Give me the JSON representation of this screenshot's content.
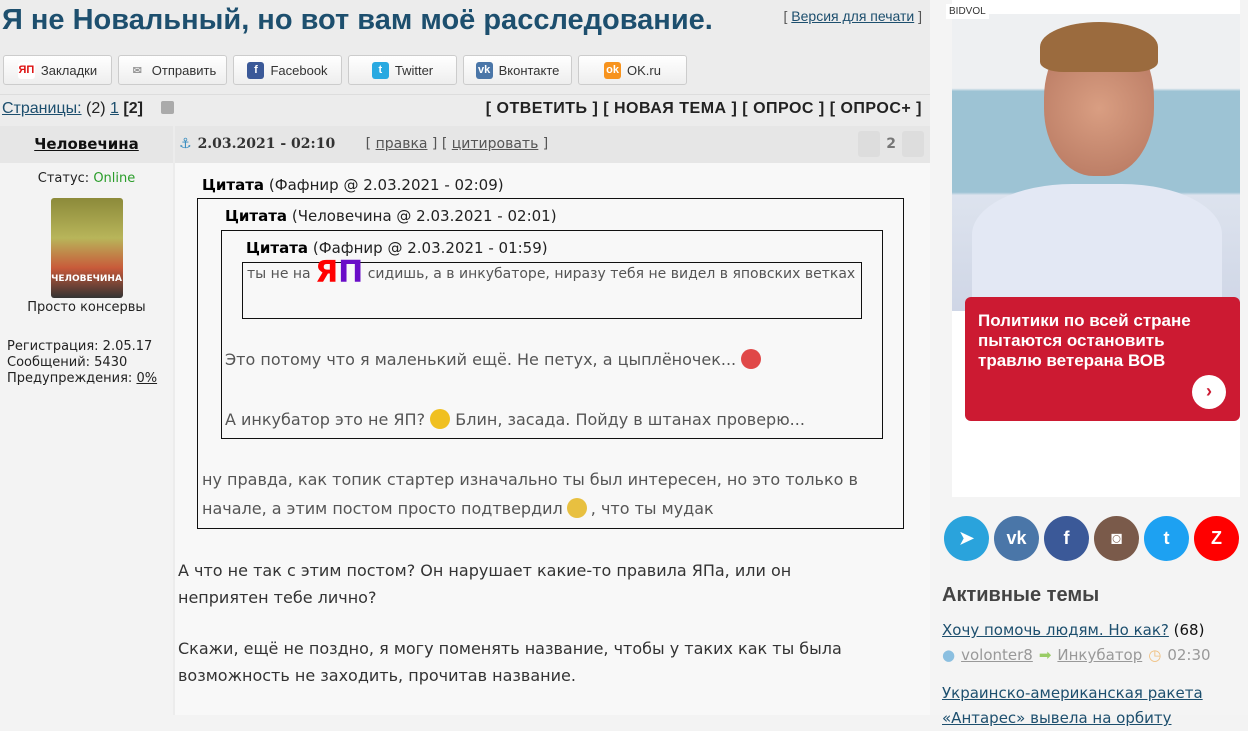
{
  "title": "Я не Новальный, но вот вам моё расследование.",
  "print_link": "Версия для печати",
  "share": [
    {
      "label": "Закладки",
      "icon": "ЯП",
      "color": "#d11"
    },
    {
      "label": "Отправить",
      "icon": "✉",
      "color": "#999"
    },
    {
      "label": "Facebook",
      "icon": "f",
      "color": "#3b5998"
    },
    {
      "label": "Twitter",
      "icon": "t",
      "color": "#29a9e1"
    },
    {
      "label": "Вконтакте",
      "icon": "vk",
      "color": "#4a76a8"
    },
    {
      "label": "OK.ru",
      "icon": "ok",
      "color": "#f7931e"
    }
  ],
  "pages": {
    "label": "Страницы:",
    "count": "(2)",
    "page1": "1",
    "current": "[2]"
  },
  "actions": "[ ОТВЕТИТЬ ] [ НОВАЯ ТЕМА ] [ ОПРОС ] [ ОПРОС+ ]",
  "user": {
    "name": "Человечина",
    "status_label": "Статус:",
    "status": "Online",
    "avatar_text": "ЧЕЛОВЕЧИНА",
    "rank": "Просто консервы",
    "reg": "Регистрация: 2.05.17",
    "posts": "Сообщений: 5430",
    "warn_label": "Предупреждения:",
    "warn": "0%"
  },
  "post": {
    "date": "2.03.2021 - 02:10",
    "edit": "правка",
    "quote": "цитировать",
    "votes": "2",
    "q1_label": "Цитата",
    "q1_meta": "(Фафнир @ 2.03.2021 - 02:09)",
    "q2_label": "Цитата",
    "q2_meta": "(Человечина @ 2.03.2021 - 02:01)",
    "q3_label": "Цитата",
    "q3_meta": "(Фафнир @ 2.03.2021 - 01:59)",
    "q3_pre": "ты не на",
    "q3_logo_1": "Я",
    "q3_logo_2": "П",
    "q3_post": "сидишь, а в инкубаторе, ниразу тебя не видел в яповских ветках",
    "q2_line1": "Это потому что я маленький ещё. Не петух, а цыплёночек...",
    "q2_line2a": "А инкубатор это не ЯП?",
    "q2_line2b": "Блин, засада. Пойду в штанах проверю...",
    "q1_line1": "ну правда, как топик стартер изначально ты был интересен, но это только в",
    "q1_line2a": "начале, а этим постом просто подтвердил",
    "q1_line2b": ", что ты мудак",
    "text1": "А что не так с этим постом? Он нарушает какие-то правила ЯПа, или он неприятен тебе лично?",
    "text2": "Скажи, ещё не поздно, я могу поменять название, чтобы у таких как ты была возможность не заходить, прочитав название."
  },
  "ad": {
    "label": "BIDVOL",
    "text": "Политики по всей стране пытаются остановить травлю ветерана ВОВ"
  },
  "socials": [
    {
      "name": "telegram",
      "color": "#2aa3dc",
      "glyph": "➤"
    },
    {
      "name": "vk",
      "color": "#4a76a8",
      "glyph": "vk"
    },
    {
      "name": "facebook",
      "color": "#3b5998",
      "glyph": "f"
    },
    {
      "name": "instagram",
      "color": "#7a5a4a",
      "glyph": "◙"
    },
    {
      "name": "twitter",
      "color": "#1da1f2",
      "glyph": "t"
    },
    {
      "name": "zen",
      "color": "#f00",
      "glyph": "Z"
    }
  ],
  "active": {
    "heading": "Активные темы",
    "t1": "Хочу помочь людям. Но как?",
    "t1_count": "(68)",
    "t1_user": "volonter8",
    "t1_forum": "Инкубатор",
    "t1_time": "02:30",
    "t2": "Украинско-американская ракета «Антарес» вывела на орбиту"
  }
}
